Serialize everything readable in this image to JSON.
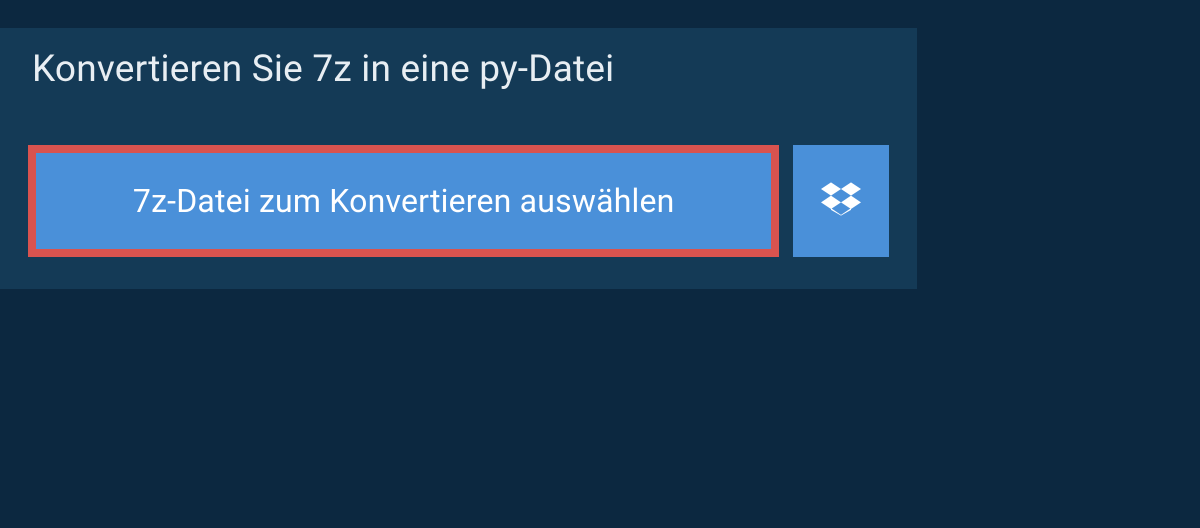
{
  "header": {
    "title": "Konvertieren Sie 7z in eine py-Datei"
  },
  "actions": {
    "select_file_label": "7z-Datei zum Konvertieren auswählen"
  },
  "colors": {
    "background": "#0c2840",
    "panel": "#143a56",
    "accent": "#4a90d9",
    "highlight_border": "#d9534f"
  }
}
